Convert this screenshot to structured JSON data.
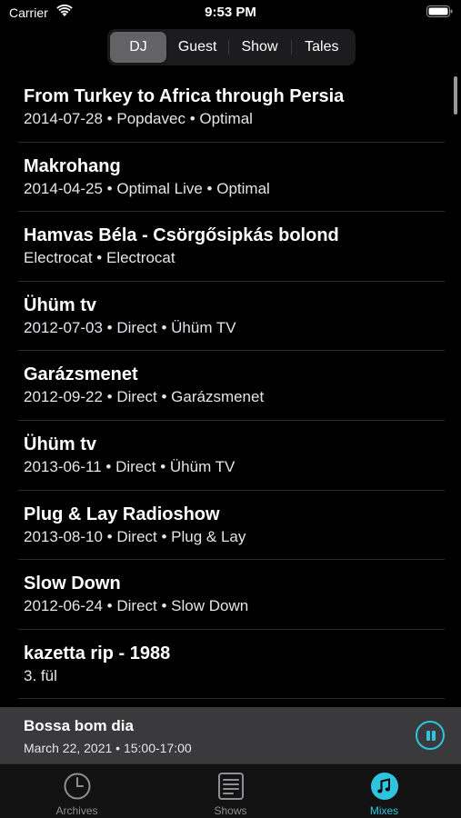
{
  "status": {
    "carrier": "Carrier",
    "time": "9:53 PM"
  },
  "segments": [
    "DJ",
    "Guest",
    "Show",
    "Tales"
  ],
  "mixes": [
    {
      "title": "From Turkey to Africa through Persia",
      "subtitle": "2014-07-28 • Popdavec • Optimal"
    },
    {
      "title": "Makrohang",
      "subtitle": "2014-04-25 • Optimal Live • Optimal"
    },
    {
      "title": "Hamvas Béla - Csörgősipkás bolond",
      "subtitle": "Electrocat • Electrocat"
    },
    {
      "title": "Ühüm tv",
      "subtitle": "2012-07-03 • Direct • Ühüm TV"
    },
    {
      "title": "Garázsmenet",
      "subtitle": "2012-09-22 • Direct • Garázsmenet"
    },
    {
      "title": "Ühüm tv",
      "subtitle": "2013-06-11 • Direct • Ühüm TV"
    },
    {
      "title": "Plug & Lay Radioshow",
      "subtitle": "2013-08-10 • Direct • Plug & Lay"
    },
    {
      "title": "Slow Down",
      "subtitle": "2012-06-24 • Direct • Slow Down"
    },
    {
      "title": "kazetta rip - 1988",
      "subtitle": "3. fül"
    }
  ],
  "now_playing": {
    "title": "Bossa bom dia",
    "time": "March 22, 2021 • 15:00-17:00"
  },
  "tabs": [
    {
      "label": "Archives",
      "icon": "clock-icon"
    },
    {
      "label": "Shows",
      "icon": "document-icon"
    },
    {
      "label": "Mixes",
      "icon": "music-note-icon"
    }
  ],
  "colors": {
    "accent": "#2ec4e0",
    "background": "#000000",
    "player_bar": "#3a3a3c"
  }
}
